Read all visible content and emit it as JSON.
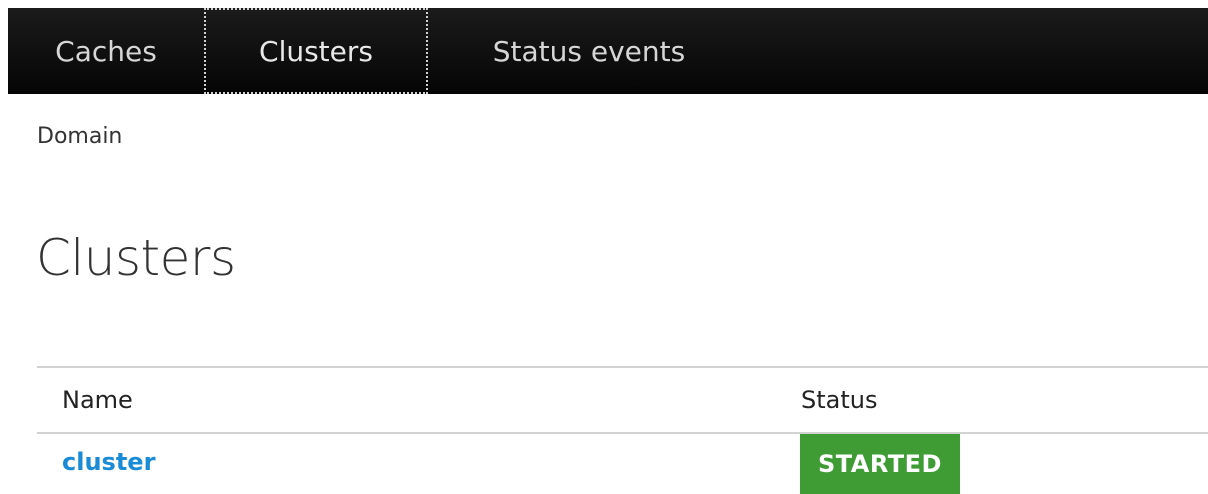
{
  "nav": {
    "tabs": [
      {
        "label": "Caches"
      },
      {
        "label": "Clusters"
      },
      {
        "label": "Status events"
      }
    ]
  },
  "breadcrumb": "Domain",
  "page_title": "Clusters",
  "table": {
    "columns": [
      "Name",
      "Status"
    ],
    "rows": [
      {
        "name": "cluster",
        "status": "STARTED"
      }
    ]
  },
  "colors": {
    "nav_background": "#0a0a0a",
    "link": "#1a8bd6",
    "status_started": "#3f9c35"
  }
}
